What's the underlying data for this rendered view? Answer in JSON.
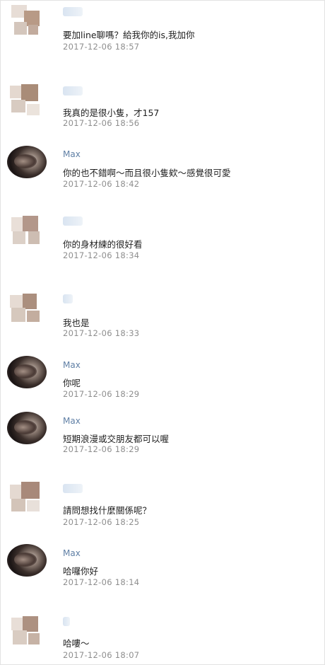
{
  "messages": [
    {
      "sender": "",
      "text": "要加line聊嗎？給我你的is,我加你",
      "time": "2017-12-06 18:57"
    },
    {
      "sender": "",
      "text": "我真的是很小隻，才157",
      "time": "2017-12-06 18:56"
    },
    {
      "sender": "Max",
      "text": "你的也不錯啊～而且很小隻欸～感覺很可愛",
      "time": "2017-12-06 18:42"
    },
    {
      "sender": "",
      "text": "你的身材練的很好看",
      "time": "2017-12-06 18:34"
    },
    {
      "sender": "",
      "text": "我也是",
      "time": "2017-12-06 18:33"
    },
    {
      "sender": "Max",
      "text": "你呢",
      "time": "2017-12-06 18:29"
    },
    {
      "sender": "Max",
      "text": "短期浪漫或交朋友都可以喔",
      "time": "2017-12-06 18:29"
    },
    {
      "sender": "",
      "text": "請問想找什麼關係呢？",
      "time": "2017-12-06 18:25"
    },
    {
      "sender": "Max",
      "text": "哈囉你好",
      "time": "2017-12-06 18:14"
    },
    {
      "sender": "",
      "text": "哈嘍～",
      "time": "2017-12-06 18:07"
    }
  ],
  "colors": {
    "name": "#5f7fa5",
    "text": "#1f1f1f",
    "time": "#8e8e8e"
  }
}
